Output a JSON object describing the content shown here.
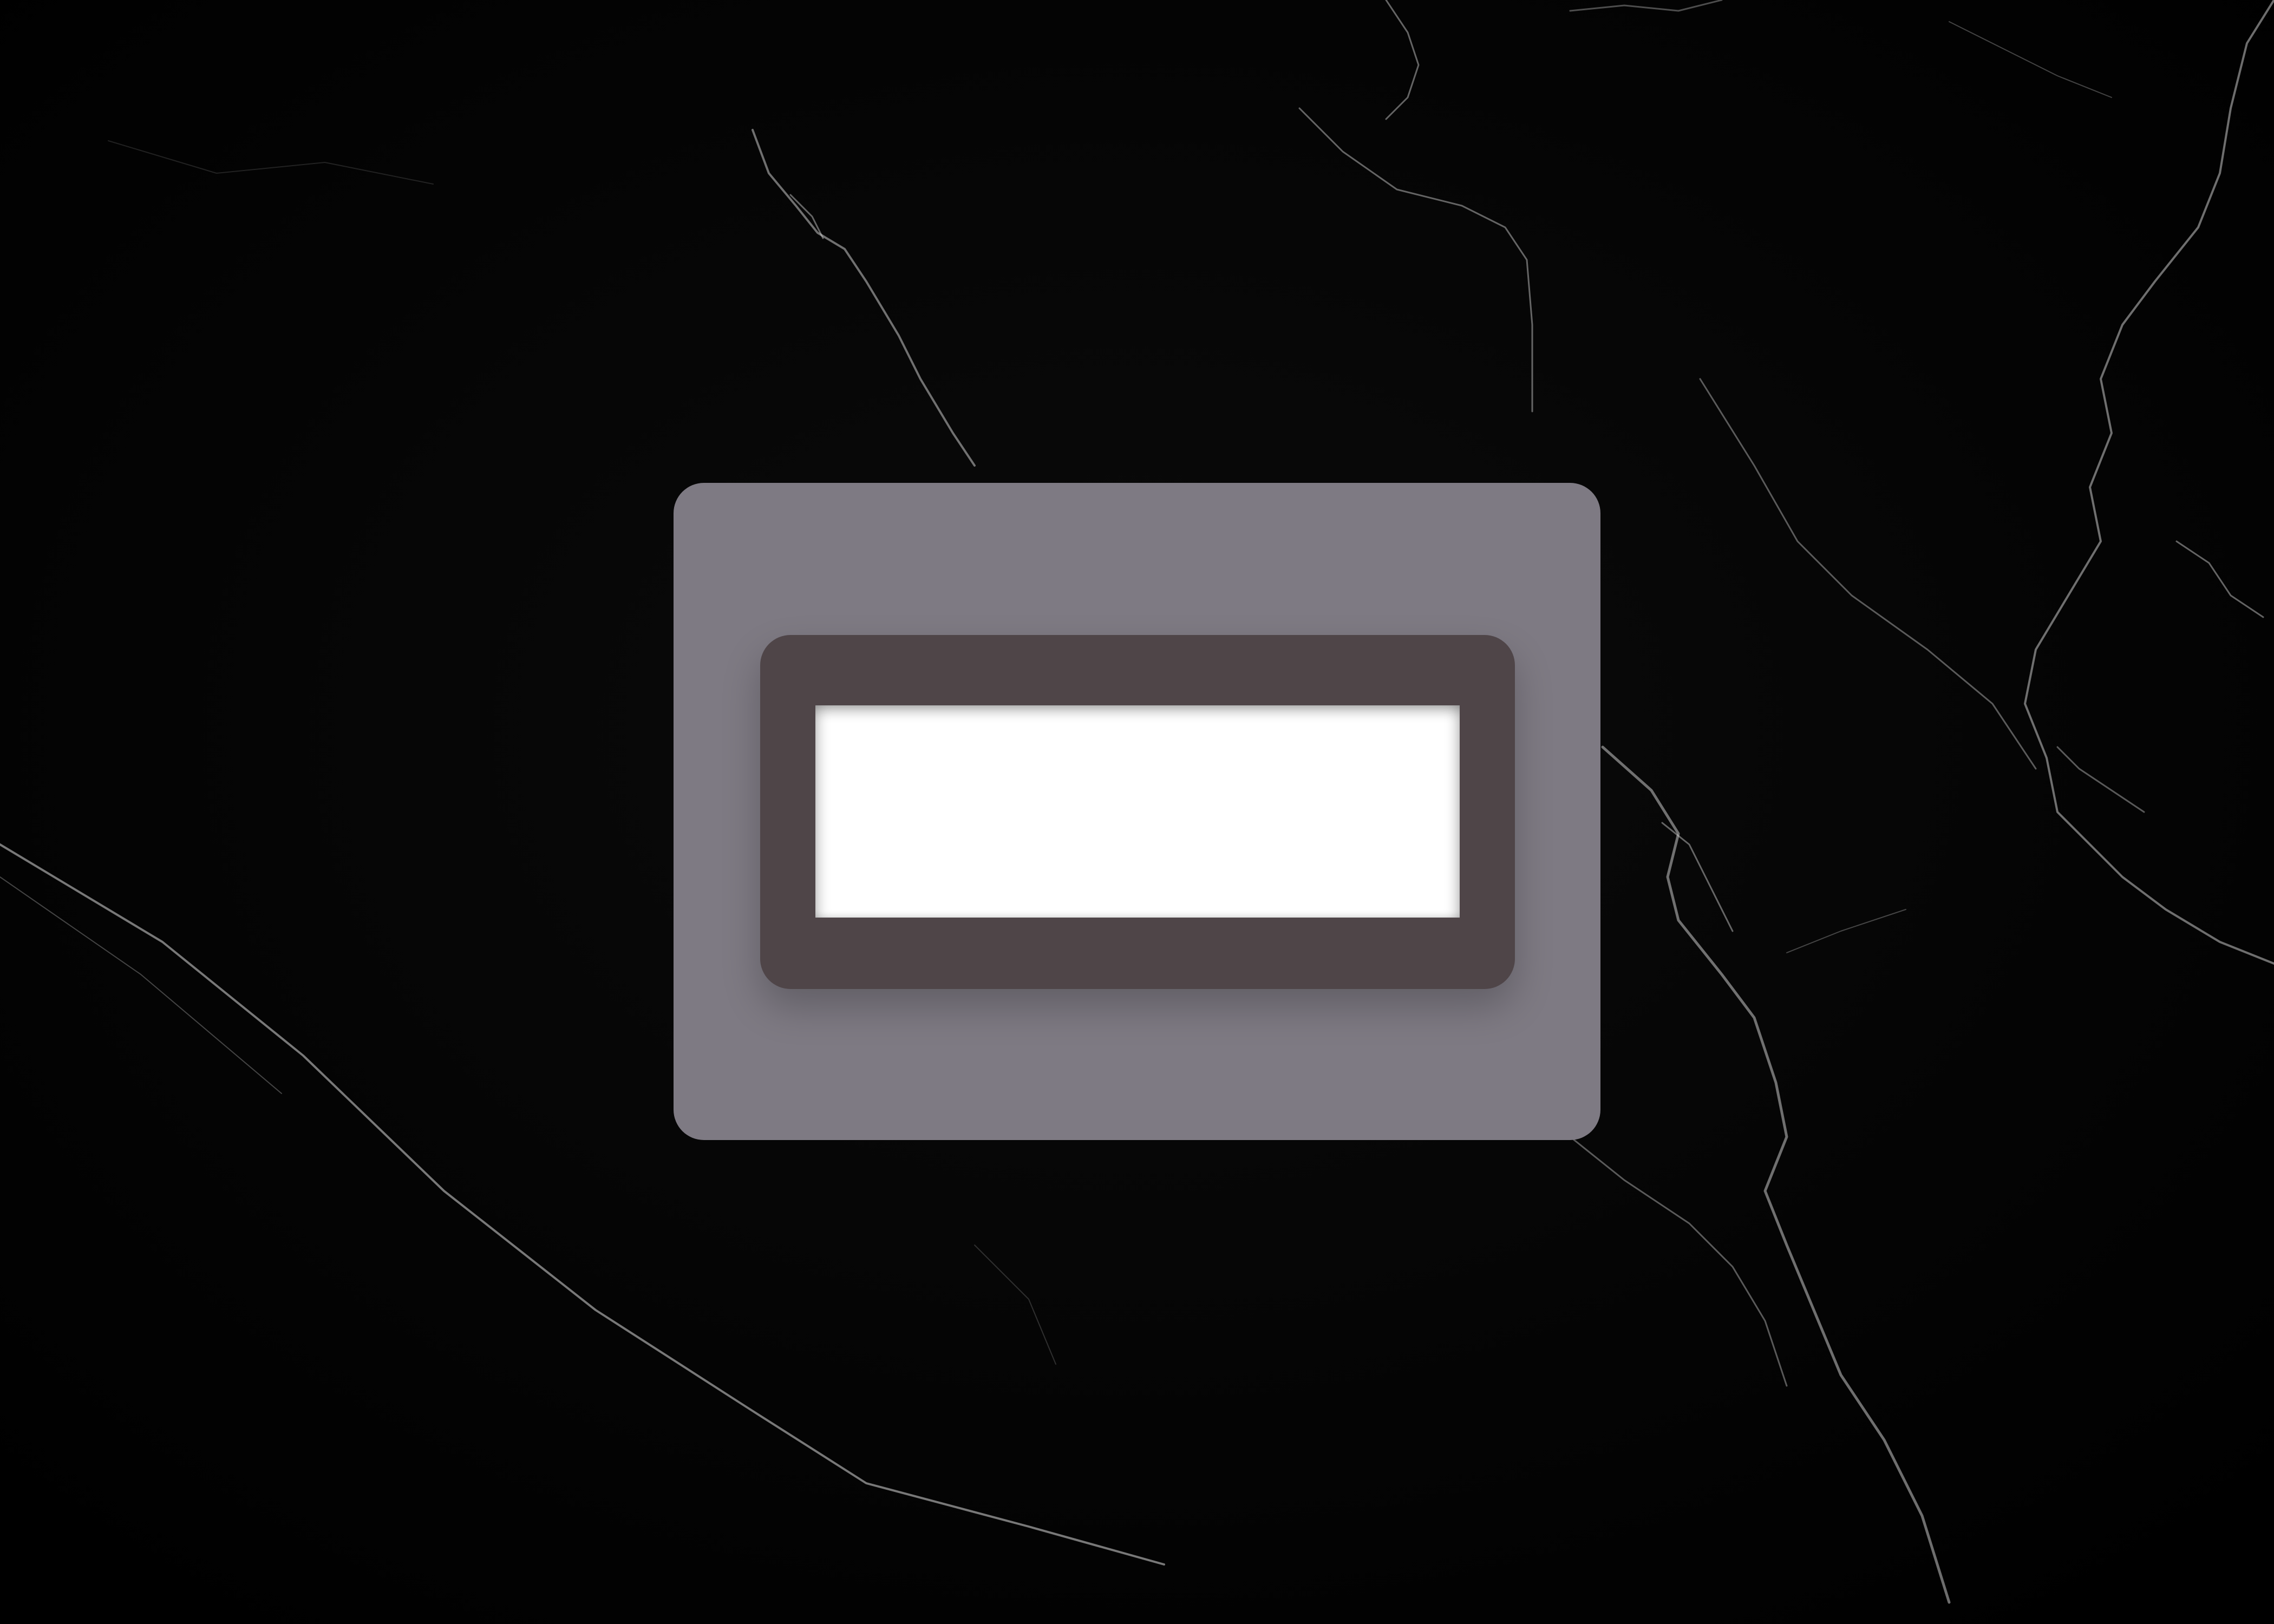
{
  "background": {
    "texture": "black-marble",
    "color": "#020202",
    "vein_color": "#d9d9d9"
  },
  "card": {
    "color": "#7e7a83"
  },
  "display_frame": {
    "color": "#4f4548"
  },
  "display_slot": {
    "color": "#ffffff",
    "text": ""
  }
}
